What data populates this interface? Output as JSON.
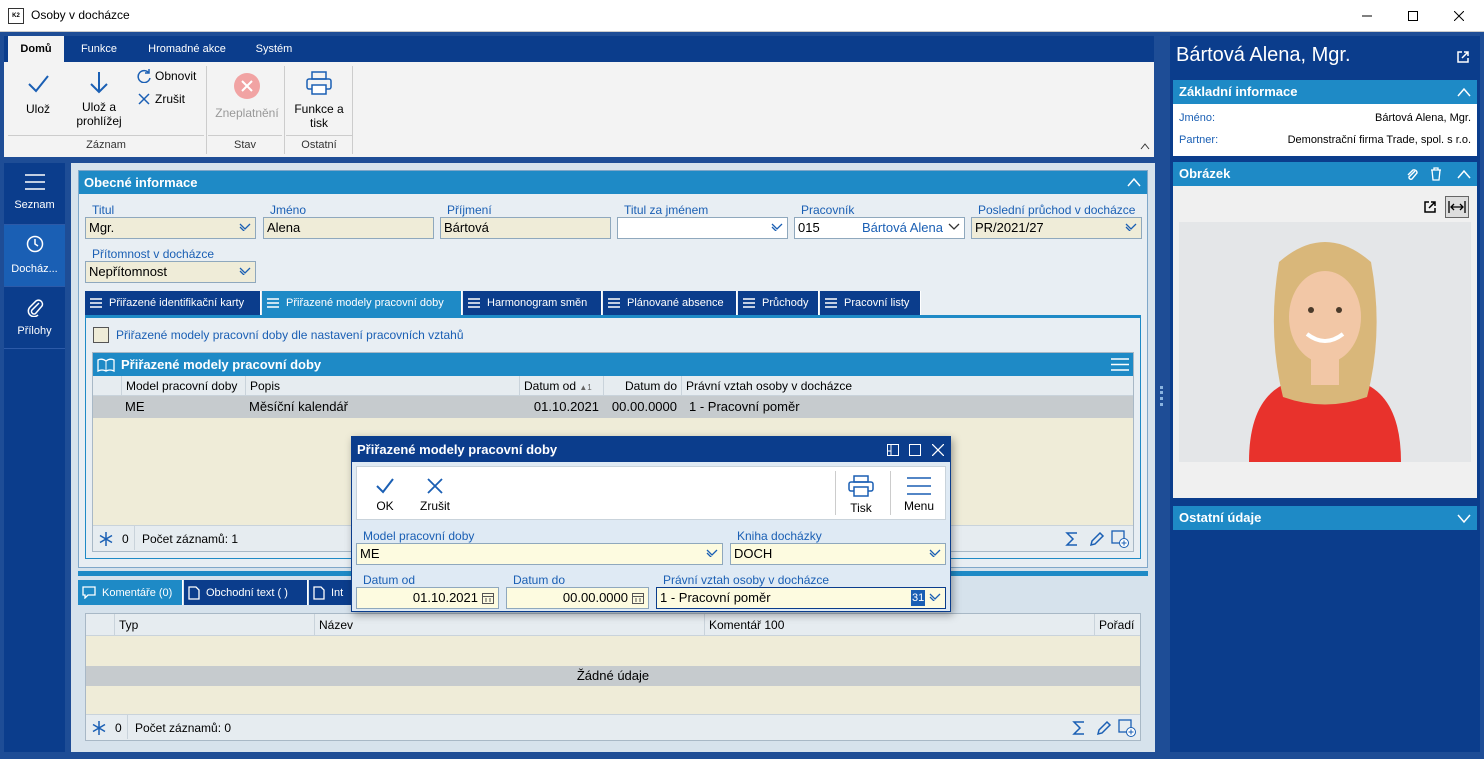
{
  "window": {
    "title": "Osoby v docházce",
    "logo": "K2"
  },
  "ribbon": {
    "tabs": [
      "Domů",
      "Funkce",
      "Hromadné akce",
      "Systém"
    ],
    "save": "Ulož",
    "save_browse": "Ulož a prohlížej",
    "refresh": "Obnovit",
    "cancel": "Zrušit",
    "invalidate": "Zneplatnění",
    "print_fn": "Funkce a tisk",
    "groups": {
      "record": "Záznam",
      "state": "Stav",
      "other": "Ostatní"
    }
  },
  "leftnav": [
    {
      "label": "Seznam",
      "icon": "hamburger-icon"
    },
    {
      "label": "Docház...",
      "icon": "clock-icon"
    },
    {
      "label": "Přílohy",
      "icon": "paperclip-icon"
    }
  ],
  "general": {
    "header": "Obecné informace",
    "title_label": "Titul",
    "title_value": "Mgr.",
    "first_label": "Jméno",
    "first_value": "Alena",
    "last_label": "Příjmení",
    "last_value": "Bártová",
    "suffix_label": "Titul za jménem",
    "suffix_value": "",
    "worker_label": "Pracovník",
    "worker_code": "015",
    "worker_name": "Bártová Alena",
    "last_pass_label": "Poslední průchod v docházce",
    "last_pass_value": "PR/2021/27",
    "presence_label": "Přítomnost v docházce",
    "presence_value": "Nepřítomnost"
  },
  "tabs": [
    "Přiřazené identifikační karty",
    "Přiřazené modely pracovní doby",
    "Harmonogram směn",
    "Plánované absence",
    "Průchody",
    "Pracovní listy"
  ],
  "assigned": {
    "checkbox_label": "Přiřazené modely pracovní doby dle nastavení pracovních vztahů",
    "grid_title": "Přiřazené modely pracovní doby",
    "columns": [
      "Model pracovní doby",
      "Popis",
      "Datum od",
      "Datum do",
      "Právní vztah osoby v docházce"
    ],
    "sort_indicator": "▲1",
    "rows": [
      [
        "ME",
        "Měsíční kalendář",
        "01.10.2021",
        "00.00.0000",
        "1 - Pracovní poměr"
      ]
    ],
    "footer_count": "0",
    "footer_records": "Počet záznamů: 1"
  },
  "bottom": {
    "tabs": [
      "Komentáře (0)",
      "Obchodní text ( )",
      "Int"
    ],
    "columns": [
      "Typ",
      "Název",
      "Komentář 100",
      "Pořadí"
    ],
    "empty": "Žádné údaje",
    "footer_count": "0",
    "footer_records": "Počet záznamů: 0"
  },
  "right": {
    "name": "Bártová Alena, Mgr.",
    "basic_header": "Základní informace",
    "name_label": "Jméno:",
    "name_value": "Bártová Alena, Mgr.",
    "partner_label": "Partner:",
    "partner_value": "Demonstrační firma Trade, spol. s r.o.",
    "image_header": "Obrázek",
    "other_header": "Ostatní údaje"
  },
  "dialog": {
    "title": "Přiřazené modely pracovní doby",
    "ok": "OK",
    "cancel": "Zrušit",
    "print": "Tisk",
    "menu": "Menu",
    "model_label": "Model pracovní doby",
    "model_value": "ME",
    "book_label": "Kniha docházky",
    "book_value": "DOCH",
    "from_label": "Datum od",
    "from_value": "01.10.2021",
    "to_label": "Datum do",
    "to_value": "00.00.0000",
    "relation_label": "Právní vztah osoby v docházce",
    "relation_value": "1 - Pracovní poměr",
    "relation_badge": "31"
  },
  "colors": {
    "dark_blue": "#0b3d8c",
    "accent_blue": "#1e8ac6",
    "field_bg": "#efecd8"
  }
}
